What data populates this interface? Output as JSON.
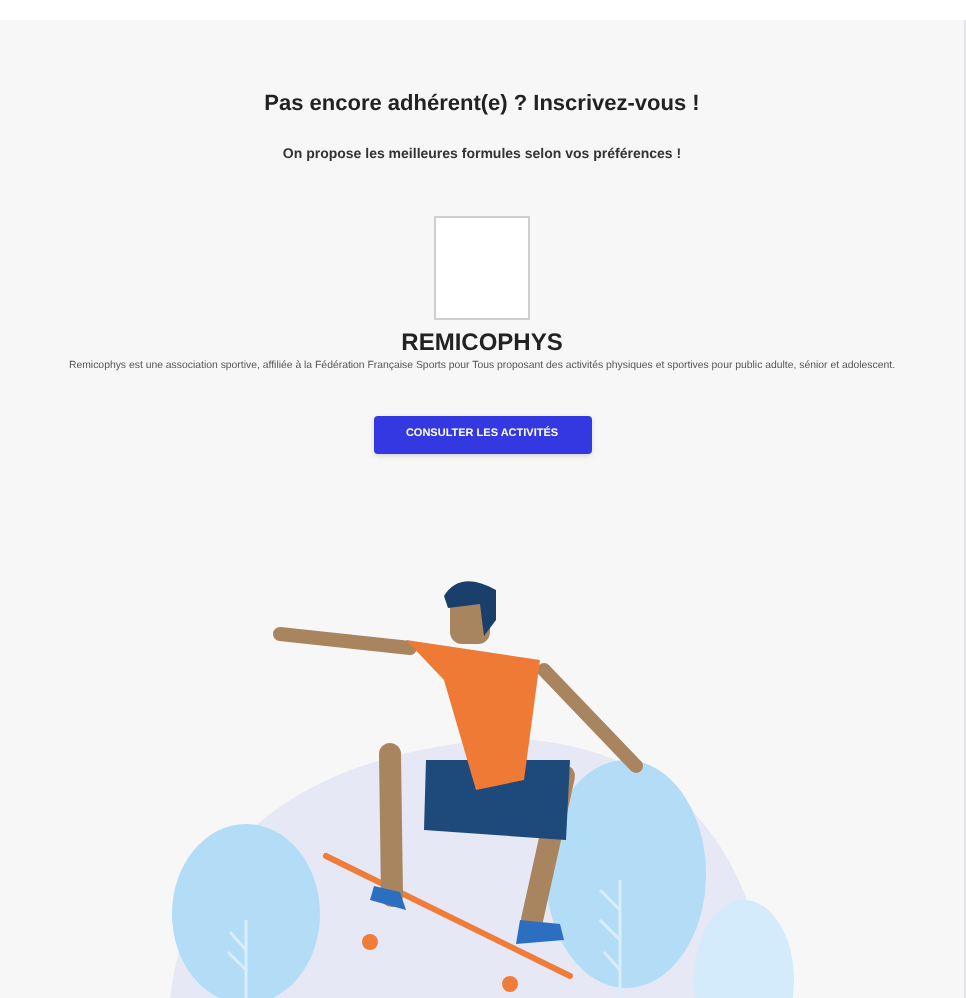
{
  "heading": "Pas encore adhérent(e) ? Inscrivez-vous !",
  "subheading": "On propose les meilleures formules selon vos préférences !",
  "club": {
    "name": "REMICOPHYS",
    "description": "Remicophys est une association sportive, affiliée à la Fédération Française Sports pour Tous proposant des activités physiques et sportives pour public adulte, sénior et adolescent."
  },
  "button": {
    "label": "CONSULTER LES ACTIVITÉS"
  }
}
